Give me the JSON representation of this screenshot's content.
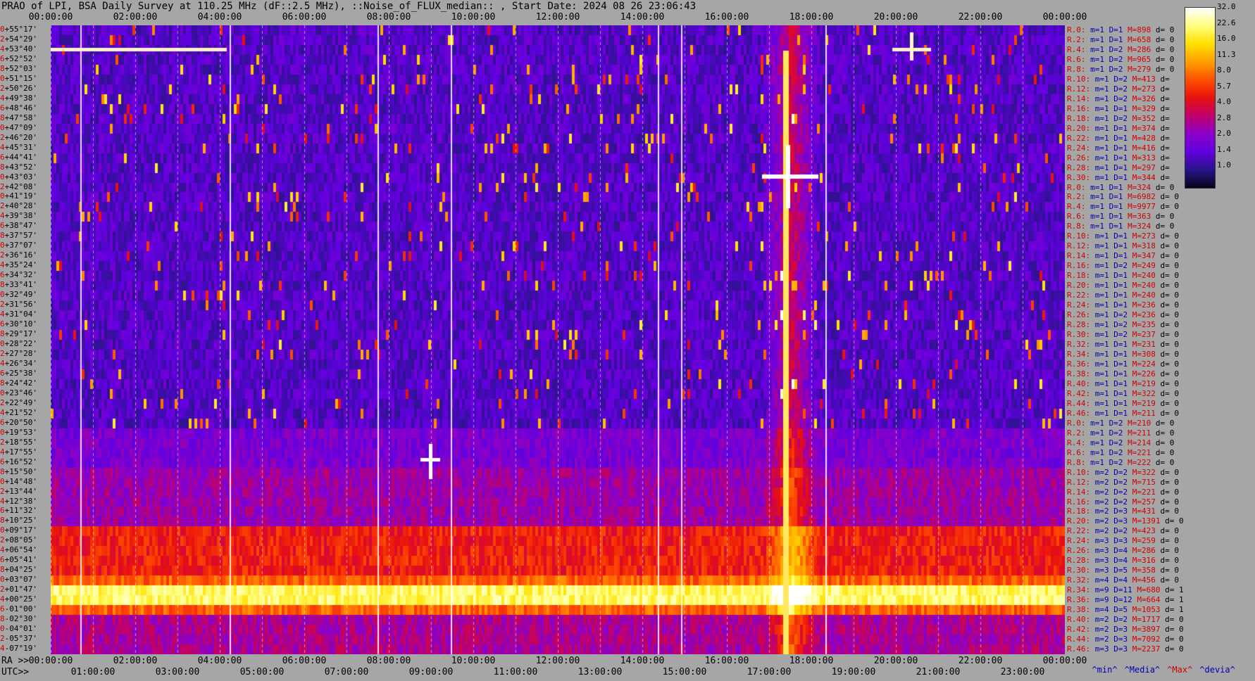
{
  "title": "PRAO of LPI, BSA Daily Survey at 110.25 MHz (dF::2.5 MHz), ::Noise_of_FLUX_median:: , Start Date: 2024 08 26 23:06:43",
  "top_axis_ticks": [
    "00:00:00",
    "02:00:00",
    "04:00:00",
    "06:00:00",
    "08:00:00",
    "10:00:00",
    "12:00:00",
    "14:00:00",
    "16:00:00",
    "18:00:00",
    "20:00:00",
    "22:00:00",
    "00:00:00"
  ],
  "ra_axis": {
    "label": "RA >>",
    "ticks": [
      "00:00:00",
      "02:00:00",
      "04:00:00",
      "06:00:00",
      "08:00:00",
      "10:00:00",
      "12:00:00",
      "14:00:00",
      "16:00:00",
      "18:00:00",
      "20:00:00",
      "22:00:00",
      "00:00:00"
    ]
  },
  "utc_axis": {
    "label": "UTC>>",
    "ticks": [
      "01:00:00",
      "03:00:00",
      "05:00:00",
      "07:00:00",
      "09:00:00",
      "11:00:00",
      "13:00:00",
      "15:00:00",
      "17:00:00",
      "19:00:00",
      "21:00:00",
      "23:00:00"
    ]
  },
  "declinations": [
    {
      "i": "0",
      "d": "+55°17'"
    },
    {
      "i": "2",
      "d": "+54°29'"
    },
    {
      "i": "4",
      "d": "+53°40'"
    },
    {
      "i": "6",
      "d": "+52°52'"
    },
    {
      "i": "8",
      "d": "+52°03'"
    },
    {
      "i": "0",
      "d": "+51°15'"
    },
    {
      "i": "2",
      "d": "+50°26'"
    },
    {
      "i": "4",
      "d": "+49°38'"
    },
    {
      "i": "6",
      "d": "+48°46'"
    },
    {
      "i": "8",
      "d": "+47°58'"
    },
    {
      "i": "0",
      "d": "+47°09'"
    },
    {
      "i": "2",
      "d": "+46°20'"
    },
    {
      "i": "4",
      "d": "+45°31'"
    },
    {
      "i": "6",
      "d": "+44°41'"
    },
    {
      "i": "8",
      "d": "+43°52'"
    },
    {
      "i": "0",
      "d": "+43°03'"
    },
    {
      "i": "2",
      "d": "+42°08'"
    },
    {
      "i": "0",
      "d": "+41°19'"
    },
    {
      "i": "2",
      "d": "+40°28'"
    },
    {
      "i": "4",
      "d": "+39°38'"
    },
    {
      "i": "6",
      "d": "+38°47'"
    },
    {
      "i": "8",
      "d": "+37°57'"
    },
    {
      "i": "0",
      "d": "+37°07'"
    },
    {
      "i": "2",
      "d": "+36°16'"
    },
    {
      "i": "4",
      "d": "+35°24'"
    },
    {
      "i": "6",
      "d": "+34°32'"
    },
    {
      "i": "8",
      "d": "+33°41'"
    },
    {
      "i": "0",
      "d": "+32°49'"
    },
    {
      "i": "2",
      "d": "+31°56'"
    },
    {
      "i": "4",
      "d": "+31°04'"
    },
    {
      "i": "6",
      "d": "+30°10'"
    },
    {
      "i": "8",
      "d": "+29°17'"
    },
    {
      "i": "0",
      "d": "+28°22'"
    },
    {
      "i": "2",
      "d": "+27°28'"
    },
    {
      "i": "4",
      "d": "+26°34'"
    },
    {
      "i": "6",
      "d": "+25°38'"
    },
    {
      "i": "8",
      "d": "+24°42'"
    },
    {
      "i": "0",
      "d": "+23°46'"
    },
    {
      "i": "2",
      "d": "+22°49'"
    },
    {
      "i": "4",
      "d": "+21°52'"
    },
    {
      "i": "6",
      "d": "+20°50'"
    },
    {
      "i": "0",
      "d": "+19°53'"
    },
    {
      "i": "2",
      "d": "+18°55'"
    },
    {
      "i": "4",
      "d": "+17°55'"
    },
    {
      "i": "6",
      "d": "+16°52'"
    },
    {
      "i": "8",
      "d": "+15°50'"
    },
    {
      "i": "0",
      "d": "+14°48'"
    },
    {
      "i": "2",
      "d": "+13°44'"
    },
    {
      "i": "4",
      "d": "+12°38'"
    },
    {
      "i": "6",
      "d": "+11°32'"
    },
    {
      "i": "8",
      "d": "+10°25'"
    },
    {
      "i": "0",
      "d": "+09°17'"
    },
    {
      "i": "2",
      "d": "+08°05'"
    },
    {
      "i": "4",
      "d": "+06°54'"
    },
    {
      "i": "6",
      "d": "+05°41'"
    },
    {
      "i": "8",
      "d": "+04°25'"
    },
    {
      "i": "0",
      "d": "+03°07'"
    },
    {
      "i": "2",
      "d": "+01°47'"
    },
    {
      "i": "4",
      "d": "+00°25'"
    },
    {
      "i": "6",
      "d": "-01°00'"
    },
    {
      "i": "8",
      "d": "-02°30'"
    },
    {
      "i": "0",
      "d": "-04°01'"
    },
    {
      "i": "2",
      "d": "-05°37'"
    },
    {
      "i": "4",
      "d": "-07°19'"
    }
  ],
  "stats_rows": [
    {
      "r": "R.0:",
      "m": "1",
      "D": "1",
      "M": "898",
      "d": "0"
    },
    {
      "r": "R.2:",
      "m": "1",
      "D": "1",
      "M": "658",
      "d": "0"
    },
    {
      "r": "R.4:",
      "m": "1",
      "D": "2",
      "M": "286",
      "d": "0"
    },
    {
      "r": "R.6:",
      "m": "1",
      "D": "2",
      "M": "965",
      "d": "0"
    },
    {
      "r": "R.8:",
      "m": "1",
      "D": "2",
      "M": "279",
      "d": "0"
    },
    {
      "r": "R.10:",
      "m": "1",
      "D": "2",
      "M": "413",
      "d": ""
    },
    {
      "r": "R.12:",
      "m": "1",
      "D": "2",
      "M": "273",
      "d": ""
    },
    {
      "r": "R.14:",
      "m": "1",
      "D": "2",
      "M": "326",
      "d": ""
    },
    {
      "r": "R.16:",
      "m": "1",
      "D": "1",
      "M": "329",
      "d": ""
    },
    {
      "r": "R.18:",
      "m": "1",
      "D": "2",
      "M": "352",
      "d": ""
    },
    {
      "r": "R.20:",
      "m": "1",
      "D": "1",
      "M": "374",
      "d": ""
    },
    {
      "r": "R.22:",
      "m": "1",
      "D": "1",
      "M": "428",
      "d": ""
    },
    {
      "r": "R.24:",
      "m": "1",
      "D": "1",
      "M": "416",
      "d": ""
    },
    {
      "r": "R.26:",
      "m": "1",
      "D": "1",
      "M": "313",
      "d": ""
    },
    {
      "r": "R.28:",
      "m": "1",
      "D": "1",
      "M": "297",
      "d": ""
    },
    {
      "r": "R.30:",
      "m": "1",
      "D": "1",
      "M": "344",
      "d": ""
    },
    {
      "r": "R.0:",
      "m": "1",
      "D": "1",
      "M": "324",
      "d": "0"
    },
    {
      "r": "R.2:",
      "m": "1",
      "D": "1",
      "M": "6982",
      "d": "0"
    },
    {
      "r": "R.4:",
      "m": "1",
      "D": "1",
      "M": "9977",
      "d": "0"
    },
    {
      "r": "R.6:",
      "m": "1",
      "D": "1",
      "M": "363",
      "d": "0"
    },
    {
      "r": "R.8:",
      "m": "1",
      "D": "1",
      "M": "324",
      "d": "0"
    },
    {
      "r": "R.10:",
      "m": "1",
      "D": "1",
      "M": "273",
      "d": "0"
    },
    {
      "r": "R.12:",
      "m": "1",
      "D": "1",
      "M": "318",
      "d": "0"
    },
    {
      "r": "R.14:",
      "m": "1",
      "D": "1",
      "M": "347",
      "d": "0"
    },
    {
      "r": "R.16:",
      "m": "1",
      "D": "2",
      "M": "249",
      "d": "0"
    },
    {
      "r": "R.18:",
      "m": "1",
      "D": "1",
      "M": "240",
      "d": "0"
    },
    {
      "r": "R.20:",
      "m": "1",
      "D": "1",
      "M": "240",
      "d": "0"
    },
    {
      "r": "R.22:",
      "m": "1",
      "D": "1",
      "M": "240",
      "d": "0"
    },
    {
      "r": "R.24:",
      "m": "1",
      "D": "1",
      "M": "236",
      "d": "0"
    },
    {
      "r": "R.26:",
      "m": "1",
      "D": "2",
      "M": "236",
      "d": "0"
    },
    {
      "r": "R.28:",
      "m": "1",
      "D": "2",
      "M": "235",
      "d": "0"
    },
    {
      "r": "R.30:",
      "m": "1",
      "D": "2",
      "M": "237",
      "d": "0"
    },
    {
      "r": "R.32:",
      "m": "1",
      "D": "1",
      "M": "231",
      "d": "0"
    },
    {
      "r": "R.34:",
      "m": "1",
      "D": "1",
      "M": "308",
      "d": "0"
    },
    {
      "r": "R.36:",
      "m": "1",
      "D": "1",
      "M": "224",
      "d": "0"
    },
    {
      "r": "R.38:",
      "m": "1",
      "D": "1",
      "M": "226",
      "d": "0"
    },
    {
      "r": "R.40:",
      "m": "1",
      "D": "1",
      "M": "219",
      "d": "0"
    },
    {
      "r": "R.42:",
      "m": "1",
      "D": "1",
      "M": "322",
      "d": "0"
    },
    {
      "r": "R.44:",
      "m": "1",
      "D": "1",
      "M": "219",
      "d": "0"
    },
    {
      "r": "R.46:",
      "m": "1",
      "D": "1",
      "M": "211",
      "d": "0"
    },
    {
      "r": "R.0:",
      "m": "1",
      "D": "2",
      "M": "210",
      "d": "0"
    },
    {
      "r": "R.2:",
      "m": "1",
      "D": "2",
      "M": "211",
      "d": "0"
    },
    {
      "r": "R.4:",
      "m": "1",
      "D": "2",
      "M": "214",
      "d": "0"
    },
    {
      "r": "R.6:",
      "m": "1",
      "D": "2",
      "M": "221",
      "d": "0"
    },
    {
      "r": "R.8:",
      "m": "1",
      "D": "2",
      "M": "222",
      "d": "0"
    },
    {
      "r": "R.10:",
      "m": "2",
      "D": "2",
      "M": "322",
      "d": "0"
    },
    {
      "r": "R.12:",
      "m": "2",
      "D": "2",
      "M": "715",
      "d": "0"
    },
    {
      "r": "R.14:",
      "m": "2",
      "D": "2",
      "M": "221",
      "d": "0"
    },
    {
      "r": "R.16:",
      "m": "2",
      "D": "2",
      "M": "257",
      "d": "0"
    },
    {
      "r": "R.18:",
      "m": "2",
      "D": "3",
      "M": "431",
      "d": "0"
    },
    {
      "r": "R.20:",
      "m": "2",
      "D": "3",
      "M": "1391",
      "d": "0"
    },
    {
      "r": "R.22:",
      "m": "2",
      "D": "2",
      "M": "423",
      "d": "0"
    },
    {
      "r": "R.24:",
      "m": "3",
      "D": "3",
      "M": "259",
      "d": "0"
    },
    {
      "r": "R.26:",
      "m": "3",
      "D": "4",
      "M": "286",
      "d": "0"
    },
    {
      "r": "R.28:",
      "m": "3",
      "D": "4",
      "M": "316",
      "d": "0"
    },
    {
      "r": "R.30:",
      "m": "3",
      "D": "5",
      "M": "358",
      "d": "0"
    },
    {
      "r": "R.32:",
      "m": "4",
      "D": "4",
      "M": "456",
      "d": "0"
    },
    {
      "r": "R.34:",
      "m": "9",
      "D": "11",
      "M": "680",
      "d": "1"
    },
    {
      "r": "R.36:",
      "m": "9",
      "D": "12",
      "M": "664",
      "d": "1"
    },
    {
      "r": "R.38:",
      "m": "4",
      "D": "5",
      "M": "1053",
      "d": "1"
    },
    {
      "r": "R.40:",
      "m": "2",
      "D": "2",
      "M": "1717",
      "d": "0"
    },
    {
      "r": "R.42:",
      "m": "2",
      "D": "3",
      "M": "3897",
      "d": "0"
    },
    {
      "r": "R.44:",
      "m": "2",
      "D": "3",
      "M": "7092",
      "d": "0"
    },
    {
      "r": "R.46:",
      "m": "3",
      "D": "3",
      "M": "2237",
      "d": "0"
    }
  ],
  "stat_legend": {
    "min": "^min^",
    "median": "^Media^",
    "max": "^Max^",
    "devia": "^devia^"
  },
  "colorbar": {
    "labels": [
      "32.0",
      "22.6",
      "16.0",
      "11.3",
      "8.0",
      "5.7",
      "4.0",
      "2.8",
      "2.0",
      "1.4",
      "1.0"
    ],
    "colors": [
      "#ffffff",
      "#ffff80",
      "#ffe000",
      "#ffa000",
      "#ff5000",
      "#e81010",
      "#c0006a",
      "#8a00c8",
      "#6000e0",
      "#2a1488",
      "#060418"
    ]
  }
}
